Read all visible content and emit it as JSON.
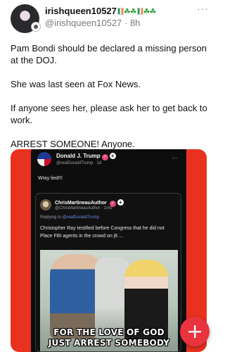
{
  "post": {
    "display_name": "irishqueen10527",
    "handle": "@irishqueen10527",
    "separator": "·",
    "time": "8h",
    "paragraphs": [
      "Pam Bondi should be declared a missing person at the DOJ.",
      "She was last seen at Fox News.",
      "If anyone sees her, please ask her to get back to work.",
      "ARREST SOMEONE! Anyone."
    ]
  },
  "embedded_post": {
    "name": "Donald J. Trump",
    "handle": "@realDonaldTrump",
    "time": "1d",
    "text": "Wray lied!!!",
    "quote": {
      "name": "ChrisMartineauAuthor",
      "handle": "@ChrisMartineauAuthor",
      "time": "1mo",
      "reply_prefix": "Replying to",
      "reply_to": "@realDonaldTrump",
      "text": "Christopher Ray testified before Congress that he did not Place FBI agents in the crowd on j6 ...",
      "meme_caption_line1": "FOR THE LOVE OF GOD",
      "meme_caption_line2": "JUST ARREST SOMEBODY"
    }
  },
  "icons": {
    "more": "more-horizontal-icon",
    "compose": "plus-icon"
  },
  "colors": {
    "media_background": "#e8311e",
    "fab": "#e9333f",
    "reply_link": "#6d8fe6"
  }
}
